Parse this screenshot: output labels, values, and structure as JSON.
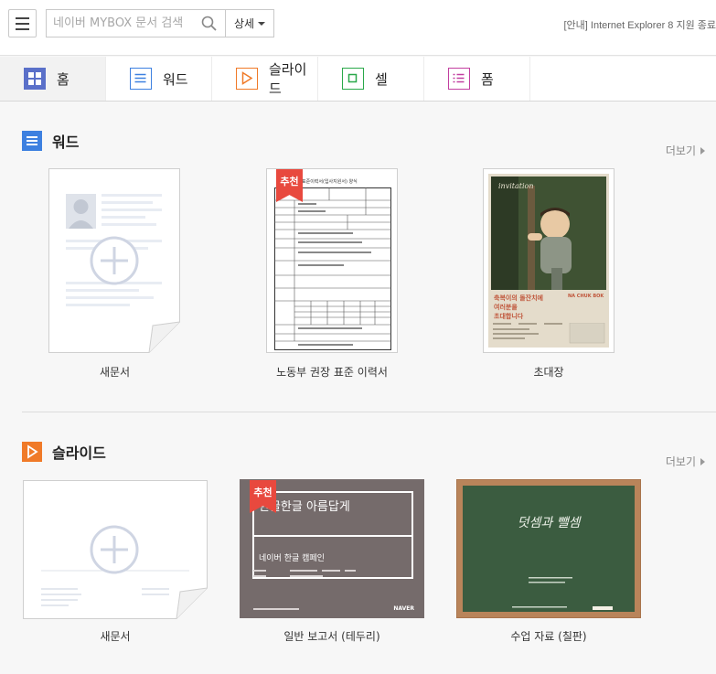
{
  "topbar": {
    "search_placeholder": "네이버 MYBOX 문서 검색",
    "detail_label": "상세",
    "notice": "[안내] Internet Explorer 8 지원 종료"
  },
  "tabs": [
    {
      "label": "홈",
      "icon": "home-grid-icon",
      "color": "#5a70c9",
      "active": true
    },
    {
      "label": "워드",
      "icon": "word-doc-icon",
      "color": "#3d80e0",
      "active": false
    },
    {
      "label": "슬라이드",
      "icon": "slide-play-icon",
      "color": "#f07a28",
      "active": false
    },
    {
      "label": "셀",
      "icon": "cell-sheet-icon",
      "color": "#2aa84a",
      "active": false
    },
    {
      "label": "폼",
      "icon": "form-list-icon",
      "color": "#c23fa0",
      "active": false
    }
  ],
  "word_section": {
    "title": "워드",
    "more_label": "더보기",
    "templates": [
      {
        "caption": "새문서",
        "badge": ""
      },
      {
        "caption": "노동부 권장 표준 이력서",
        "badge": "추천"
      },
      {
        "caption": "초대장",
        "badge": ""
      }
    ],
    "resume_thumb_title": "표준이력서(입사지원서) 양식",
    "invitation": {
      "script_text": "invitation",
      "headline_1": "축복이의 돌잔치에",
      "headline_2": "여러분을",
      "headline_3": "초대합니다",
      "name": "NA CHUK BOK"
    }
  },
  "slide_section": {
    "title": "슬라이드",
    "more_label": "더보기",
    "templates": [
      {
        "caption": "새문서",
        "badge": ""
      },
      {
        "caption": "일반 보고서 (테두리)",
        "badge": "추천"
      },
      {
        "caption": "수업 자료 (칠판)",
        "badge": ""
      }
    ],
    "report_thumb": {
      "title": "한글한글 아름답게",
      "subtitle": "네이버 한글 캠페인",
      "brand": "NAVER"
    },
    "chalkboard_thumb": {
      "title": "덧셈과 뺄셈"
    }
  },
  "colors": {
    "accent_red": "#e8493e",
    "word_blue": "#3d80e0",
    "slide_orange": "#f07a28",
    "report_bg": "#756b6b",
    "chalk_green": "#3b5c40",
    "chalk_frame": "#b9845a"
  }
}
